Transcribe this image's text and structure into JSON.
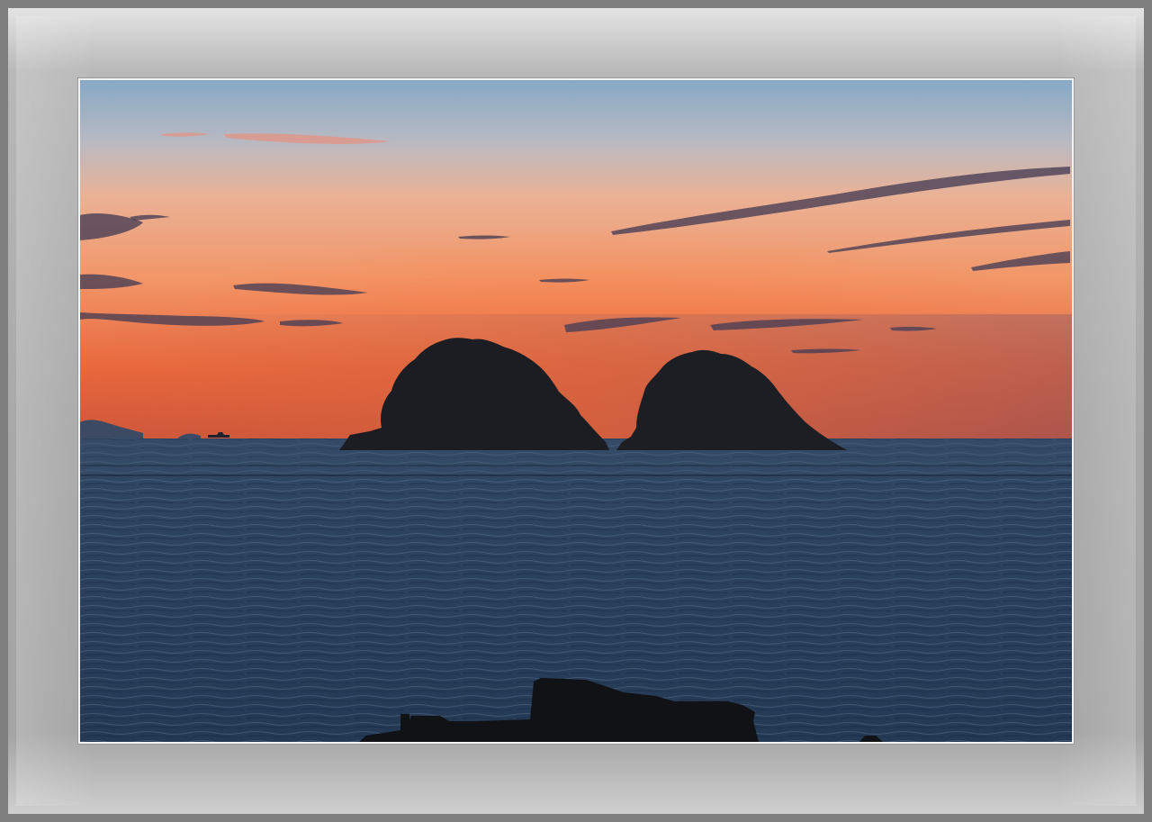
{
  "image": {
    "subject": "sunset-sea-twin-islands",
    "colors": {
      "frame_outer": "#7e7e7e",
      "mat": "#aaaaaa",
      "photo_border": "#f2f2f2",
      "sky_top": "#8fb1cc",
      "sky_mid": "#f0a97c",
      "sky_horizon": "#e2633a",
      "sea": "#2b3f58",
      "silhouette": "#1a1c20"
    }
  }
}
